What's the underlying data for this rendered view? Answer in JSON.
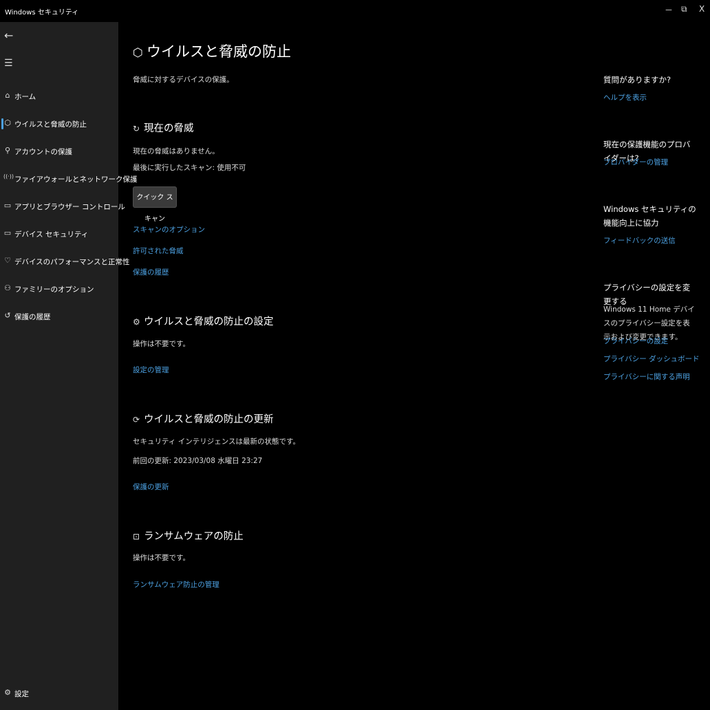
{
  "window": {
    "title": "Windows セキュリティ",
    "minimize_icon": "－",
    "restore_icon": "⧉",
    "close_icon": "X"
  },
  "sidebar": {
    "back_icon": "←",
    "menu_icon": "☰",
    "items": [
      {
        "icon": "⌂",
        "label": "ホーム"
      },
      {
        "icon": "⬡",
        "label": "ウイルスと脅威の防止"
      },
      {
        "icon": "⚲",
        "label": "アカウントの保護"
      },
      {
        "icon": "((·))",
        "label": "ファイアウォールとネットワーク保護"
      },
      {
        "icon": "▭",
        "label": "アプリとブラウザー コントロール"
      },
      {
        "icon": "▭",
        "label": "デバイス セキュリティ"
      },
      {
        "icon": "♡",
        "label": "デバイスのパフォーマンスと正常性"
      },
      {
        "icon": "⚇",
        "label": "ファミリーのオプション"
      },
      {
        "icon": "↺",
        "label": "保護の履歴"
      }
    ],
    "settings": {
      "icon": "⚙",
      "label": "設定"
    }
  },
  "page": {
    "title": "ウイルスと脅威の防止",
    "subtitle": "脅威に対するデバイスの保護。"
  },
  "current_threats": {
    "title": "現在の脅威",
    "status": "現在の脅威はありません。",
    "last_scan": "最後に実行したスキャン: 使用不可",
    "quick_scan_button": "クイック スキャン",
    "links": [
      "スキャンのオプション",
      "許可された脅威",
      "保護の履歴"
    ]
  },
  "settings_section": {
    "title": "ウイルスと脅威の防止の設定",
    "status": "操作は不要です。",
    "link": "設定の管理"
  },
  "updates_section": {
    "title": "ウイルスと脅威の防止の更新",
    "status": "セキュリティ インテリジェンスは最新の状態です。",
    "last_update": "前回の更新: 2023/03/08 水曜日 23:27",
    "link": "保護の更新"
  },
  "ransomware_section": {
    "title": "ランサムウェアの防止",
    "status": "操作は不要です。",
    "link": "ランサムウェア防止の管理"
  },
  "right_panel": {
    "help": {
      "title": "質問がありますか?",
      "link": "ヘルプを表示"
    },
    "provider": {
      "title": "現在の保護機能のプロバイダーは?",
      "link": "プロバイダーの管理"
    },
    "feedback": {
      "title": "Windows セキュリティの機能向上に協力",
      "link": "フィードバックの送信"
    },
    "privacy": {
      "title": "プライバシーの設定を変更する",
      "text": "Windows 11 Home デバイスのプライバシー設定を表示および変更できます。",
      "links": [
        "プライバシーの設定",
        "プライバシー ダッシュボード",
        "プライバシーに関する声明"
      ]
    }
  },
  "colors": {
    "link": "#4ca0e0",
    "sidebar_bg": "#202020",
    "main_bg": "#000000"
  }
}
